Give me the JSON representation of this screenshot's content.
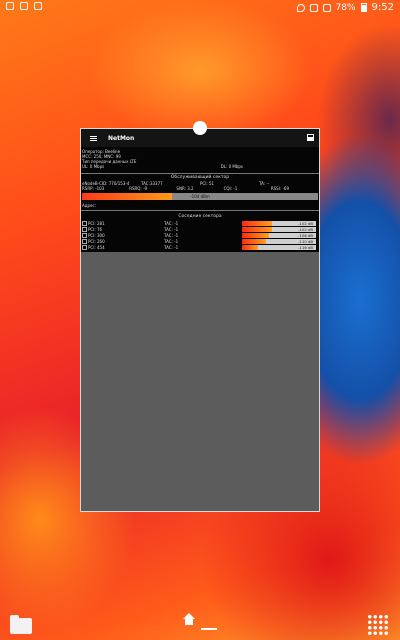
{
  "status_bar": {
    "battery": "78%",
    "time": "9:52"
  },
  "app": {
    "title": "NetMon"
  },
  "info": {
    "operator_label": "Оператор:",
    "operator_value": "Beeline",
    "mcc_mnc": "MCC: 250, MNC: 99",
    "data_type": "Тип передачи данных LTE",
    "ul": "UL: 0 Mbps",
    "dl": "DL: 0 Mbps"
  },
  "serving": {
    "title": "Обслуживающий сектор",
    "row1": [
      "eNodeB-CID: 770/153-4",
      "TAC:33377",
      "PCI: 51",
      "TA: --"
    ],
    "row2": [
      "RSRP: -103",
      "RSRQ: -9",
      "SNR: 3.2",
      "CQI: -1",
      "RSSI: -69"
    ],
    "meter_text": "-104 dBm",
    "meter_level": 0.38,
    "address_label": "Адрес:"
  },
  "neighbors": {
    "title": "Соседние сектора",
    "rows": [
      {
        "pci": "PCI: 281",
        "tac": "TAC: -1",
        "dbm": "-102 dB",
        "level": 0.4
      },
      {
        "pci": "PCI: 76",
        "tac": "TAC: -1",
        "dbm": "-102 dB",
        "level": 0.4
      },
      {
        "pci": "PCI: 300",
        "tac": "TAC: -1",
        "dbm": "-106 dB",
        "level": 0.36
      },
      {
        "pci": "PCI: 260",
        "tac": "TAC: -1",
        "dbm": "-110 dB",
        "level": 0.33
      },
      {
        "pci": "PCI: 454",
        "tac": "TAC: -1",
        "dbm": "-116 dB",
        "level": 0.22
      }
    ]
  },
  "colors": {
    "signal_high": "#ff2a10",
    "signal_low": "#ffa020",
    "widget_bg": "#5c5c5c"
  },
  "icons": {
    "menu": "menu-icon",
    "save": "save-icon",
    "folder": "folder-icon",
    "home": "home-icon",
    "apps": "apps-icon"
  }
}
